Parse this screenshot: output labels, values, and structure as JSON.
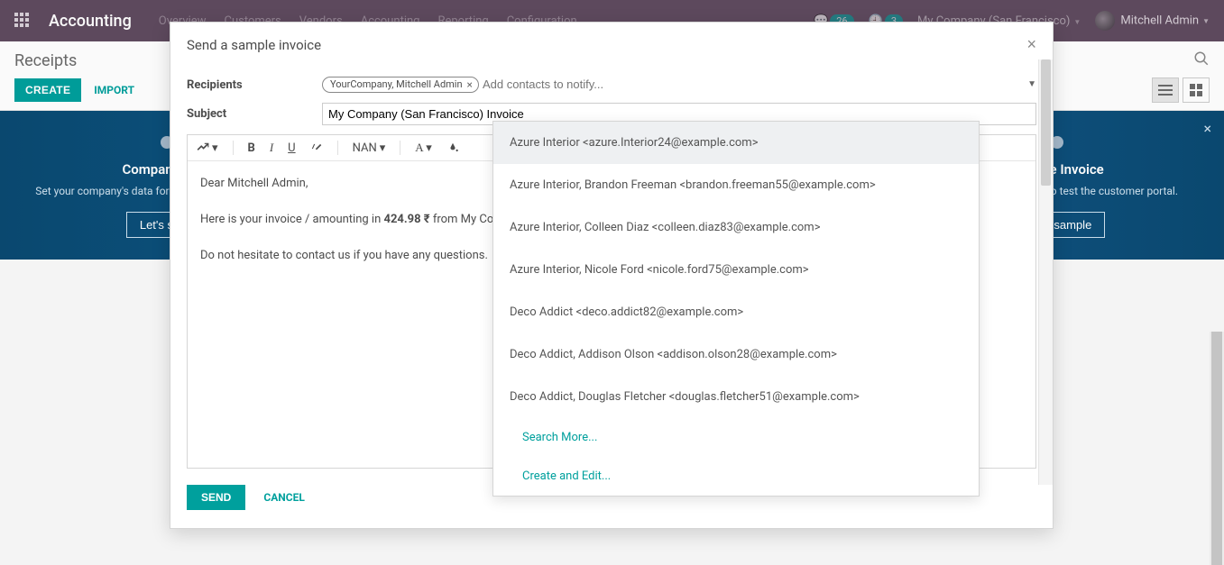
{
  "topbar": {
    "brand": "Accounting",
    "menu": [
      "Overview",
      "Customers",
      "Vendors",
      "Accounting",
      "Reporting",
      "Configuration"
    ],
    "badge1": "26",
    "badge2": "3",
    "company": "My Company (San Francisco)",
    "user": "Mitchell Admin"
  },
  "controlpanel": {
    "title": "Receipts",
    "create": "CREATE",
    "import": "IMPORT"
  },
  "banner": {
    "steps": [
      {
        "title": "Company Data",
        "desc": "Set your company's data for documents header/footer.",
        "btn": "Let's start!"
      },
      {
        "title": "",
        "desc": "",
        "btn": ""
      },
      {
        "title": "",
        "desc": "",
        "btn": ""
      },
      {
        "title": "Sample Invoice",
        "desc": "Send a sample invoice to test the customer portal.",
        "btn": "Send sample"
      }
    ]
  },
  "modal": {
    "title": "Send a sample invoice",
    "recipients_label": "Recipients",
    "subject_label": "Subject",
    "tag": "YourCompany, Mitchell Admin",
    "placeholder": "Add contacts to notify...",
    "subject": "My Company (San Francisco) Invoice",
    "toolbar_font": "NAN",
    "body_line1": "Dear Mitchell Admin,",
    "body_line2_a": "Here is your invoice / amounting in ",
    "body_line2_b": "424.98 ₹",
    "body_line2_c": " from My Company.",
    "body_line3": "Do not hesitate to contact us if you have any questions.",
    "send": "SEND",
    "cancel": "CANCEL"
  },
  "dropdown": {
    "items": [
      "Azure Interior <azure.Interior24@example.com>",
      "Azure Interior, Brandon Freeman <brandon.freeman55@example.com>",
      "Azure Interior, Colleen Diaz <colleen.diaz83@example.com>",
      "Azure Interior, Nicole Ford <nicole.ford75@example.com>",
      "Deco Addict <deco.addict82@example.com>",
      "Deco Addict, Addison Olson <addison.olson28@example.com>",
      "Deco Addict, Douglas Fletcher <douglas.fletcher51@example.com>"
    ],
    "search_more": "Search More...",
    "create_edit": "Create and Edit..."
  }
}
